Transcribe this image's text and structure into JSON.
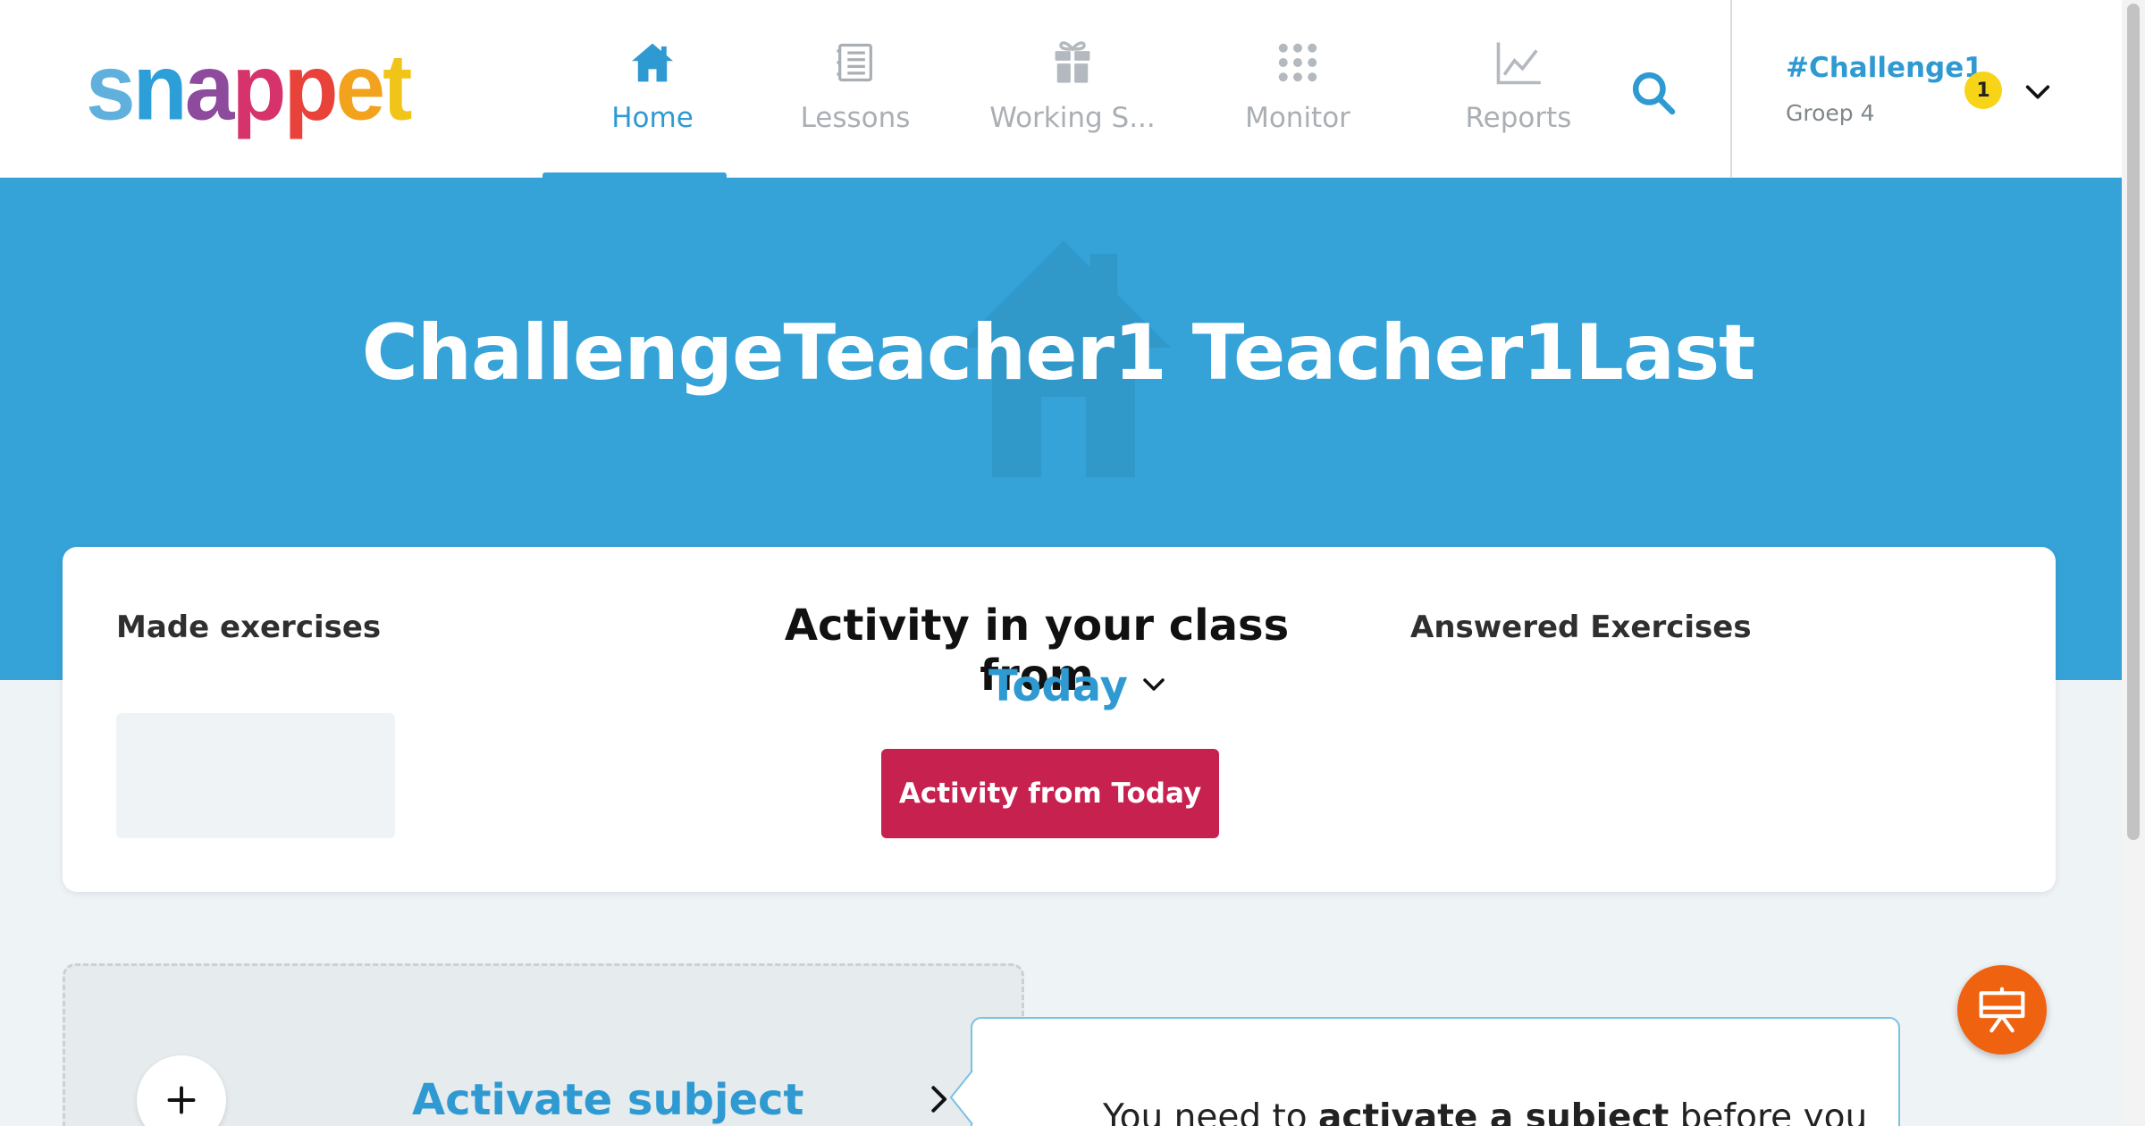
{
  "brand": {
    "logo_letters": [
      "s",
      "n",
      "a",
      "p",
      "p",
      "e",
      "t"
    ],
    "logo_colors": [
      "#5fb0dc",
      "#2c9fd8",
      "#8e4b9e",
      "#d6336c",
      "#e8423a",
      "#f3a21d",
      "#f0c419"
    ]
  },
  "nav": {
    "items": [
      {
        "label": "Home",
        "icon": "home-icon",
        "active": true
      },
      {
        "label": "Lessons",
        "icon": "notebook-icon",
        "active": false
      },
      {
        "label": "Working S...",
        "icon": "gift-icon",
        "active": false
      },
      {
        "label": "Monitor",
        "icon": "grid-dots-icon",
        "active": false
      },
      {
        "label": "Reports",
        "icon": "line-chart-icon",
        "active": false
      }
    ],
    "search_icon": "search-icon"
  },
  "account": {
    "class_name": "#Challenge1",
    "group": "Groep 4",
    "notification_count": "1"
  },
  "hero": {
    "title": "ChallengeTeacher1 Teacher1Last"
  },
  "activity_card": {
    "made_exercises_label": "Made exercises",
    "activity_title": "Activity in your class from",
    "period": "Today",
    "button_label": "Activity from Today",
    "answered_label": "Answered Exercises"
  },
  "subject": {
    "activate_label": "Activate subject",
    "tooltip_prefix": "You need to ",
    "tooltip_bold": "activate a subject",
    "tooltip_suffix": " before you"
  },
  "colors": {
    "accent": "#35a3d8",
    "primary_button": "#c72150",
    "badge": "#f7d418",
    "fab": "#ef6210"
  }
}
